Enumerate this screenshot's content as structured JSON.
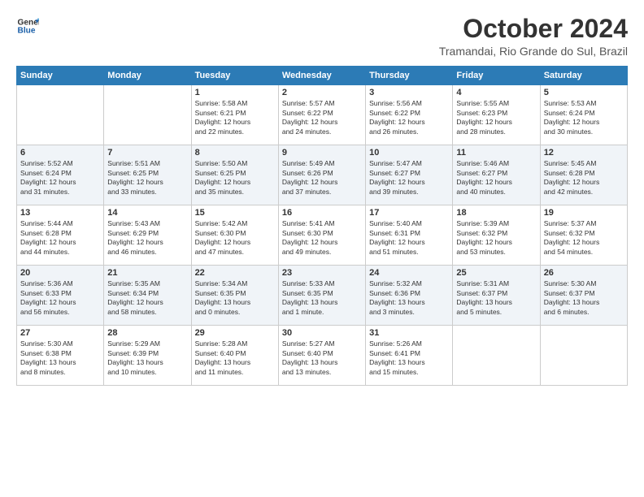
{
  "logo": {
    "line1": "General",
    "line2": "Blue"
  },
  "title": "October 2024",
  "location": "Tramandai, Rio Grande do Sul, Brazil",
  "header_days": [
    "Sunday",
    "Monday",
    "Tuesday",
    "Wednesday",
    "Thursday",
    "Friday",
    "Saturday"
  ],
  "weeks": [
    [
      {
        "day": "",
        "text": ""
      },
      {
        "day": "",
        "text": ""
      },
      {
        "day": "1",
        "text": "Sunrise: 5:58 AM\nSunset: 6:21 PM\nDaylight: 12 hours\nand 22 minutes."
      },
      {
        "day": "2",
        "text": "Sunrise: 5:57 AM\nSunset: 6:22 PM\nDaylight: 12 hours\nand 24 minutes."
      },
      {
        "day": "3",
        "text": "Sunrise: 5:56 AM\nSunset: 6:22 PM\nDaylight: 12 hours\nand 26 minutes."
      },
      {
        "day": "4",
        "text": "Sunrise: 5:55 AM\nSunset: 6:23 PM\nDaylight: 12 hours\nand 28 minutes."
      },
      {
        "day": "5",
        "text": "Sunrise: 5:53 AM\nSunset: 6:24 PM\nDaylight: 12 hours\nand 30 minutes."
      }
    ],
    [
      {
        "day": "6",
        "text": "Sunrise: 5:52 AM\nSunset: 6:24 PM\nDaylight: 12 hours\nand 31 minutes."
      },
      {
        "day": "7",
        "text": "Sunrise: 5:51 AM\nSunset: 6:25 PM\nDaylight: 12 hours\nand 33 minutes."
      },
      {
        "day": "8",
        "text": "Sunrise: 5:50 AM\nSunset: 6:25 PM\nDaylight: 12 hours\nand 35 minutes."
      },
      {
        "day": "9",
        "text": "Sunrise: 5:49 AM\nSunset: 6:26 PM\nDaylight: 12 hours\nand 37 minutes."
      },
      {
        "day": "10",
        "text": "Sunrise: 5:47 AM\nSunset: 6:27 PM\nDaylight: 12 hours\nand 39 minutes."
      },
      {
        "day": "11",
        "text": "Sunrise: 5:46 AM\nSunset: 6:27 PM\nDaylight: 12 hours\nand 40 minutes."
      },
      {
        "day": "12",
        "text": "Sunrise: 5:45 AM\nSunset: 6:28 PM\nDaylight: 12 hours\nand 42 minutes."
      }
    ],
    [
      {
        "day": "13",
        "text": "Sunrise: 5:44 AM\nSunset: 6:28 PM\nDaylight: 12 hours\nand 44 minutes."
      },
      {
        "day": "14",
        "text": "Sunrise: 5:43 AM\nSunset: 6:29 PM\nDaylight: 12 hours\nand 46 minutes."
      },
      {
        "day": "15",
        "text": "Sunrise: 5:42 AM\nSunset: 6:30 PM\nDaylight: 12 hours\nand 47 minutes."
      },
      {
        "day": "16",
        "text": "Sunrise: 5:41 AM\nSunset: 6:30 PM\nDaylight: 12 hours\nand 49 minutes."
      },
      {
        "day": "17",
        "text": "Sunrise: 5:40 AM\nSunset: 6:31 PM\nDaylight: 12 hours\nand 51 minutes."
      },
      {
        "day": "18",
        "text": "Sunrise: 5:39 AM\nSunset: 6:32 PM\nDaylight: 12 hours\nand 53 minutes."
      },
      {
        "day": "19",
        "text": "Sunrise: 5:37 AM\nSunset: 6:32 PM\nDaylight: 12 hours\nand 54 minutes."
      }
    ],
    [
      {
        "day": "20",
        "text": "Sunrise: 5:36 AM\nSunset: 6:33 PM\nDaylight: 12 hours\nand 56 minutes."
      },
      {
        "day": "21",
        "text": "Sunrise: 5:35 AM\nSunset: 6:34 PM\nDaylight: 12 hours\nand 58 minutes."
      },
      {
        "day": "22",
        "text": "Sunrise: 5:34 AM\nSunset: 6:35 PM\nDaylight: 13 hours\nand 0 minutes."
      },
      {
        "day": "23",
        "text": "Sunrise: 5:33 AM\nSunset: 6:35 PM\nDaylight: 13 hours\nand 1 minute."
      },
      {
        "day": "24",
        "text": "Sunrise: 5:32 AM\nSunset: 6:36 PM\nDaylight: 13 hours\nand 3 minutes."
      },
      {
        "day": "25",
        "text": "Sunrise: 5:31 AM\nSunset: 6:37 PM\nDaylight: 13 hours\nand 5 minutes."
      },
      {
        "day": "26",
        "text": "Sunrise: 5:30 AM\nSunset: 6:37 PM\nDaylight: 13 hours\nand 6 minutes."
      }
    ],
    [
      {
        "day": "27",
        "text": "Sunrise: 5:30 AM\nSunset: 6:38 PM\nDaylight: 13 hours\nand 8 minutes."
      },
      {
        "day": "28",
        "text": "Sunrise: 5:29 AM\nSunset: 6:39 PM\nDaylight: 13 hours\nand 10 minutes."
      },
      {
        "day": "29",
        "text": "Sunrise: 5:28 AM\nSunset: 6:40 PM\nDaylight: 13 hours\nand 11 minutes."
      },
      {
        "day": "30",
        "text": "Sunrise: 5:27 AM\nSunset: 6:40 PM\nDaylight: 13 hours\nand 13 minutes."
      },
      {
        "day": "31",
        "text": "Sunrise: 5:26 AM\nSunset: 6:41 PM\nDaylight: 13 hours\nand 15 minutes."
      },
      {
        "day": "",
        "text": ""
      },
      {
        "day": "",
        "text": ""
      }
    ]
  ]
}
